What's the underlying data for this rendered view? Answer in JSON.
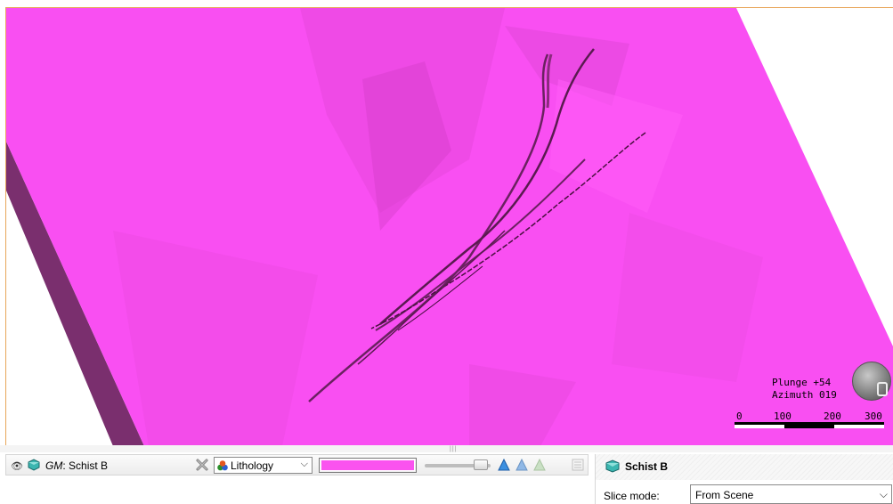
{
  "scene": {
    "surface_color": "#f94ff2",
    "side_color": "#7a2f6e",
    "hud": {
      "plunge": "Plunge +54",
      "azimuth": "Azimuth 019",
      "scale_labels": [
        "0",
        "100",
        "200",
        "300"
      ]
    }
  },
  "toolbar": {
    "visibility_icon": "eye-icon",
    "object_prefix": "GM",
    "object_name": ": Schist B",
    "colour_mode": "Lithology",
    "colour_swatch": "#fa53ef",
    "tools": [
      "slice-view-icon",
      "clip-icon",
      "fade-icon",
      "list-icon"
    ]
  },
  "properties": {
    "title": "Schist B",
    "slice_mode_label": "Slice mode:",
    "slice_mode_value": "From Scene"
  }
}
